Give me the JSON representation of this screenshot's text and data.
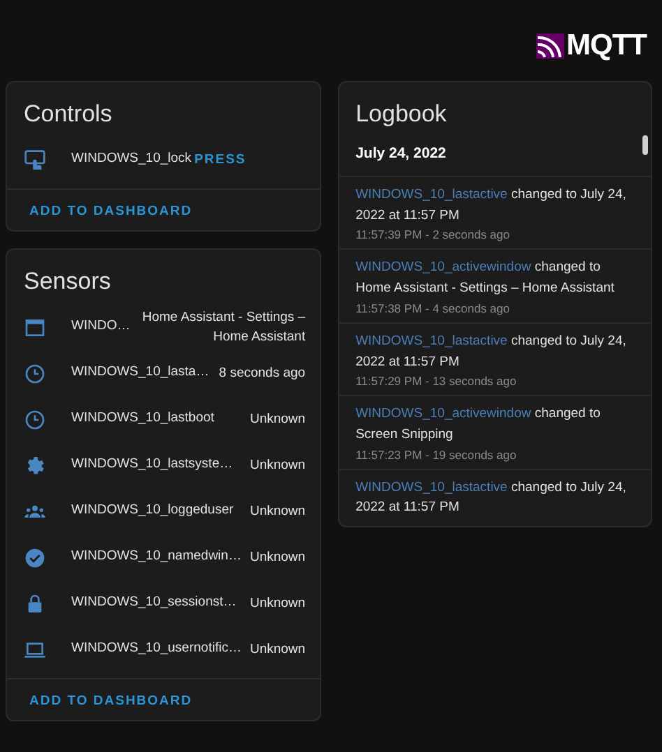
{
  "header": {
    "logo_text": "MQTT"
  },
  "controls": {
    "title": "Controls",
    "items": [
      {
        "kind": "button",
        "name": "WINDOWS_10_lock",
        "action": "PRESS"
      }
    ],
    "footer_action": "ADD TO DASHBOARD"
  },
  "sensors": {
    "title": "Sensors",
    "items": [
      {
        "kind": "window",
        "name": "WINDO…",
        "state": "Home Assistant - Settings – Home Assistant"
      },
      {
        "kind": "clock",
        "name": "WINDOWS_10_lasta…",
        "state": "8 seconds ago"
      },
      {
        "kind": "clock",
        "name": "WINDOWS_10_lastboot",
        "state": "Unknown"
      },
      {
        "kind": "gear",
        "name": "WINDOWS_10_lastsyste…",
        "state": "Unknown"
      },
      {
        "kind": "group",
        "name": "WINDOWS_10_loggeduser",
        "state": "Unknown"
      },
      {
        "kind": "check",
        "name": "WINDOWS_10_namedwin…",
        "state": "Unknown"
      },
      {
        "kind": "lock",
        "name": "WINDOWS_10_sessionst…",
        "state": "Unknown"
      },
      {
        "kind": "laptop",
        "name": "WINDOWS_10_usernotific…",
        "state": "Unknown"
      }
    ],
    "footer_action": "ADD TO DASHBOARD"
  },
  "logbook": {
    "title": "Logbook",
    "date": "July 24, 2022",
    "entries": [
      {
        "entity": "WINDOWS_10_lastactive",
        "message": "changed to July 24, 2022 at 11:57 PM",
        "time": "11:57:39 PM - 2 seconds ago"
      },
      {
        "entity": "WINDOWS_10_activewindow",
        "message": "changed to Home Assistant - Settings – Home Assistant",
        "time": "11:57:38 PM - 4 seconds ago"
      },
      {
        "entity": "WINDOWS_10_lastactive",
        "message": "changed to July 24, 2022 at 11:57 PM",
        "time": "11:57:29 PM - 13 seconds ago"
      },
      {
        "entity": "WINDOWS_10_activewindow",
        "message": "changed to Screen Snipping",
        "time": "11:57:23 PM - 19 seconds ago"
      },
      {
        "entity": "WINDOWS_10_lastactive",
        "message": "changed to July 24, 2022 at 11:57 PM"
      }
    ]
  }
}
